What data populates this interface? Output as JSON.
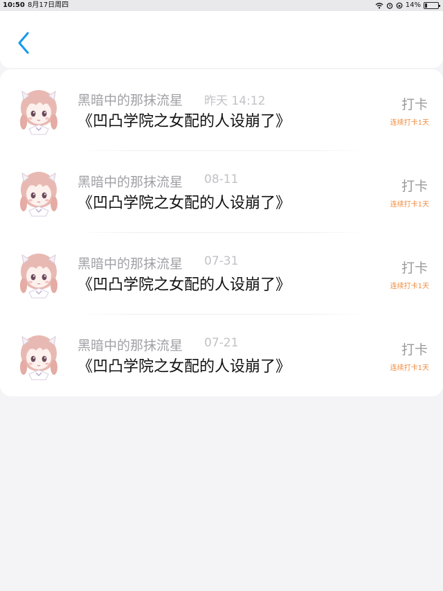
{
  "status_bar": {
    "time": "10:50",
    "date": "8月17日周四",
    "battery": "14%",
    "battery_level": 0.14
  },
  "header": {
    "back_icon": "chevron-left-icon",
    "accent": "#1a9bea"
  },
  "feed": [
    {
      "user": "黑暗中的那抹流星",
      "time": "昨天 14:12",
      "book": "《凹凸学院之女配的人设崩了》",
      "action": "打卡",
      "streak": "连续打卡1天"
    },
    {
      "user": "黑暗中的那抹流星",
      "time": "08-11",
      "book": "《凹凸学院之女配的人设崩了》",
      "action": "打卡",
      "streak": "连续打卡1天"
    },
    {
      "user": "黑暗中的那抹流星",
      "time": "07-31",
      "book": "《凹凸学院之女配的人设崩了》",
      "action": "打卡",
      "streak": "连续打卡1天"
    },
    {
      "user": "黑暗中的那抹流星",
      "time": "07-21",
      "book": "《凹凸学院之女配的人设崩了》",
      "action": "打卡",
      "streak": "连续打卡1天"
    }
  ],
  "colors": {
    "streak": "#f08a3c",
    "background": "#f4f4f6"
  }
}
